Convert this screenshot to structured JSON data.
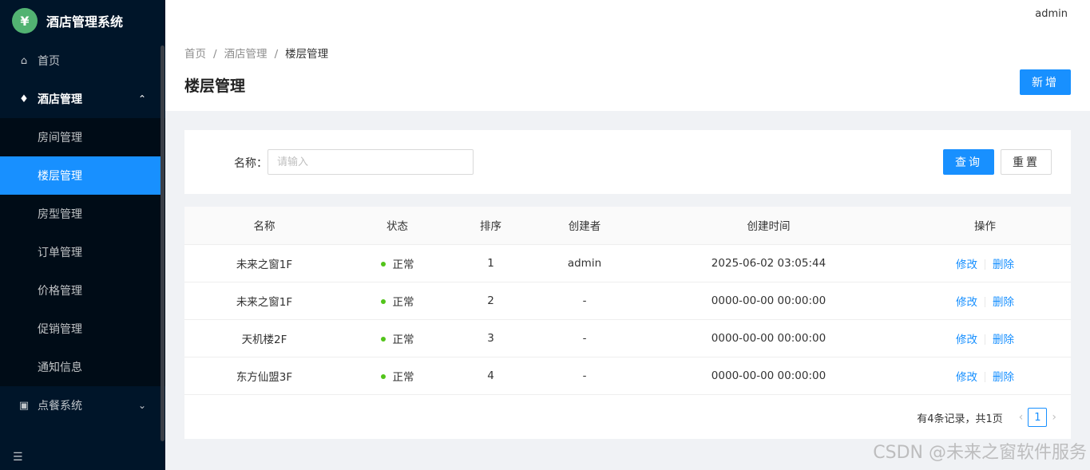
{
  "app": {
    "title": "酒店管理系统",
    "logo_glyph": "¥"
  },
  "header": {
    "user": "admin"
  },
  "sidebar": {
    "items": [
      {
        "label": "首页",
        "icon": "home-icon"
      },
      {
        "label": "酒店管理",
        "icon": "diamond-icon",
        "expanded": true
      },
      {
        "label": "点餐系统",
        "icon": "file-icon",
        "expanded": false
      }
    ],
    "submenu": [
      {
        "label": "房间管理"
      },
      {
        "label": "楼层管理",
        "active": true
      },
      {
        "label": "房型管理"
      },
      {
        "label": "订单管理"
      },
      {
        "label": "价格管理"
      },
      {
        "label": "促销管理"
      },
      {
        "label": "通知信息"
      }
    ]
  },
  "breadcrumb": [
    "首页",
    "酒店管理",
    "楼层管理"
  ],
  "page": {
    "title": "楼层管理",
    "new_label": "新增"
  },
  "search": {
    "label": "名称：",
    "placeholder": "请输入",
    "query_label": "查询",
    "reset_label": "重置"
  },
  "table": {
    "columns": [
      "名称",
      "状态",
      "排序",
      "创建者",
      "创建时间",
      "操作"
    ],
    "rows": [
      {
        "name": "未来之窗1F",
        "status": "正常",
        "order": "1",
        "creator": "admin",
        "created": "2025-06-02 03:05:44"
      },
      {
        "name": "未来之窗1F",
        "status": "正常",
        "order": "2",
        "creator": "-",
        "created": "0000-00-00 00:00:00"
      },
      {
        "name": "天机楼2F",
        "status": "正常",
        "order": "3",
        "creator": "-",
        "created": "0000-00-00 00:00:00"
      },
      {
        "name": "东方仙盟3F",
        "status": "正常",
        "order": "4",
        "creator": "-",
        "created": "0000-00-00 00:00:00"
      }
    ],
    "edit_label": "修改",
    "delete_label": "删除"
  },
  "pagination": {
    "summary": "有4条记录，共1页",
    "current": "1"
  },
  "watermark": "CSDN @未来之窗软件服务",
  "colors": {
    "primary": "#1890ff",
    "sidebar": "#001529",
    "status_ok": "#52c41a"
  }
}
